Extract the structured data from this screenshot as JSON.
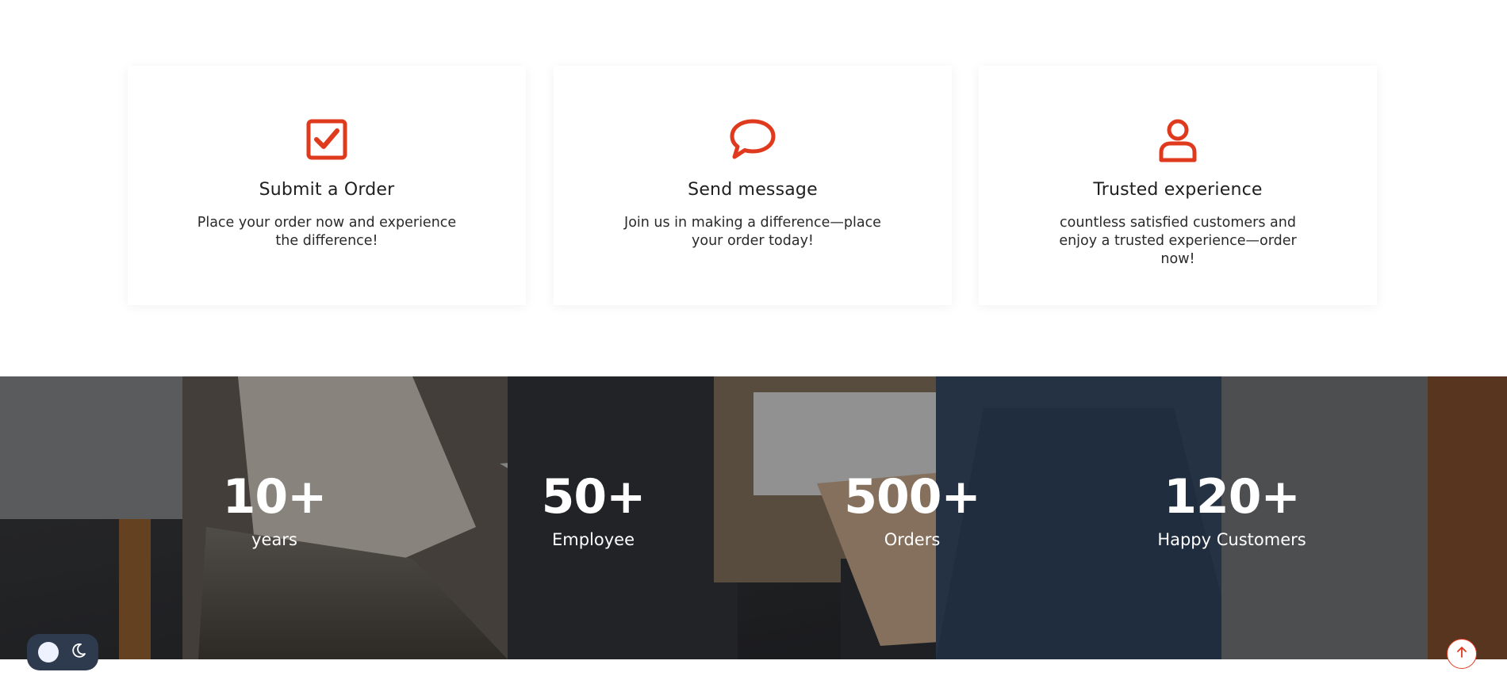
{
  "colors": {
    "accent": "#e03a1e",
    "text": "#202020"
  },
  "features": [
    {
      "icon": "checkbox-icon",
      "title": "Submit a Order",
      "desc": "Place your order now and experience the difference!"
    },
    {
      "icon": "speech-bubble-icon",
      "title": "Send message",
      "desc": "Join us in making a difference—place your order today!"
    },
    {
      "icon": "user-icon",
      "title": "Trusted experience",
      "desc": "countless satisfied customers and enjoy a trusted experience—order now!"
    }
  ],
  "stats": [
    {
      "value": "10+",
      "label": "years"
    },
    {
      "value": "50+",
      "label": "Employee"
    },
    {
      "value": "500+",
      "label": "Orders"
    },
    {
      "value": "120+",
      "label": "Happy Customers"
    }
  ],
  "controls": {
    "theme_toggle": [
      "sun-icon",
      "moon-icon"
    ],
    "scroll_top": "arrow-up-icon"
  }
}
